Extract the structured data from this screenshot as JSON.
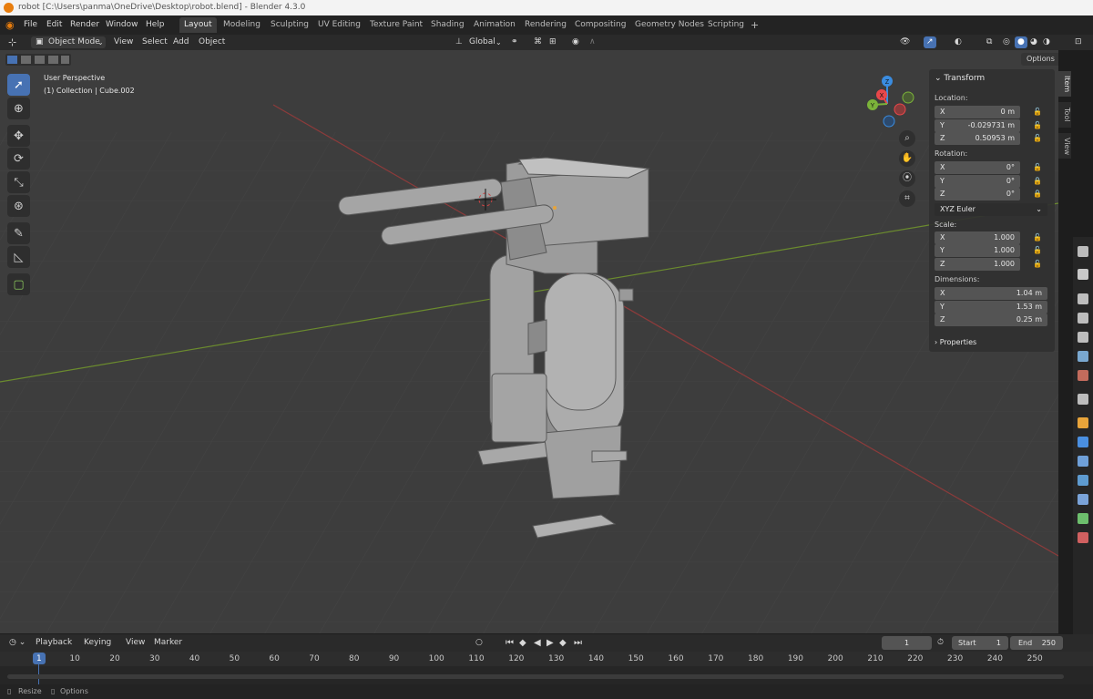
{
  "window_title": "robot [C:\\Users\\panma\\OneDrive\\Desktop\\robot.blend] - Blender 4.3.0",
  "menu": [
    "File",
    "Edit",
    "Render",
    "Window",
    "Help"
  ],
  "workspaces": [
    "Layout",
    "Modeling",
    "Sculpting",
    "UV Editing",
    "Texture Paint",
    "Shading",
    "Animation",
    "Rendering",
    "Compositing",
    "Geometry Nodes",
    "Scripting"
  ],
  "workspace_add": "+",
  "viewport_header": {
    "mode": "Object Mode",
    "menus": [
      "View",
      "Select",
      "Add",
      "Object"
    ],
    "orientation": "Global",
    "options": "Options"
  },
  "viewport": {
    "perspective": "User Perspective",
    "collection": "(1) Collection | Cube.002"
  },
  "gizmo_axes": {
    "x": "X",
    "y": "Y",
    "z": "Z"
  },
  "npanel": {
    "section": "Transform",
    "location_label": "Location:",
    "location": [
      {
        "axis": "X",
        "value": "0 m"
      },
      {
        "axis": "Y",
        "value": "-0.029731 m"
      },
      {
        "axis": "Z",
        "value": "0.50953 m"
      }
    ],
    "rotation_label": "Rotation:",
    "rotation": [
      {
        "axis": "X",
        "value": "0°"
      },
      {
        "axis": "Y",
        "value": "0°"
      },
      {
        "axis": "Z",
        "value": "0°"
      }
    ],
    "rotation_mode": "XYZ Euler",
    "scale_label": "Scale:",
    "scale": [
      {
        "axis": "X",
        "value": "1.000"
      },
      {
        "axis": "Y",
        "value": "1.000"
      },
      {
        "axis": "Z",
        "value": "1.000"
      }
    ],
    "dimensions_label": "Dimensions:",
    "dimensions": [
      {
        "axis": "X",
        "value": "1.04 m"
      },
      {
        "axis": "Y",
        "value": "1.53 m"
      },
      {
        "axis": "Z",
        "value": "0.25 m"
      }
    ],
    "properties": "Properties"
  },
  "side_tabs": [
    "Item",
    "Tool",
    "View"
  ],
  "timeline": {
    "menus": [
      "Playback",
      "Keying",
      "View",
      "Marker"
    ],
    "current_frame": "1",
    "start_label": "Start",
    "start": "1",
    "end_label": "End",
    "end": "250",
    "frames": [
      "1",
      "10",
      "20",
      "30",
      "40",
      "50",
      "60",
      "70",
      "80",
      "90",
      "100",
      "110",
      "120",
      "130",
      "140",
      "150",
      "160",
      "170",
      "180",
      "190",
      "200",
      "210",
      "220",
      "230",
      "240",
      "250"
    ]
  },
  "statusbar": {
    "resize": "Resize",
    "options": "Options"
  },
  "colors": {
    "accent": "#4772b3",
    "x_axis": "#e8474a",
    "y_axis": "#7bb33a",
    "z_axis": "#3a8ce0",
    "background": "#3d3d3d"
  }
}
